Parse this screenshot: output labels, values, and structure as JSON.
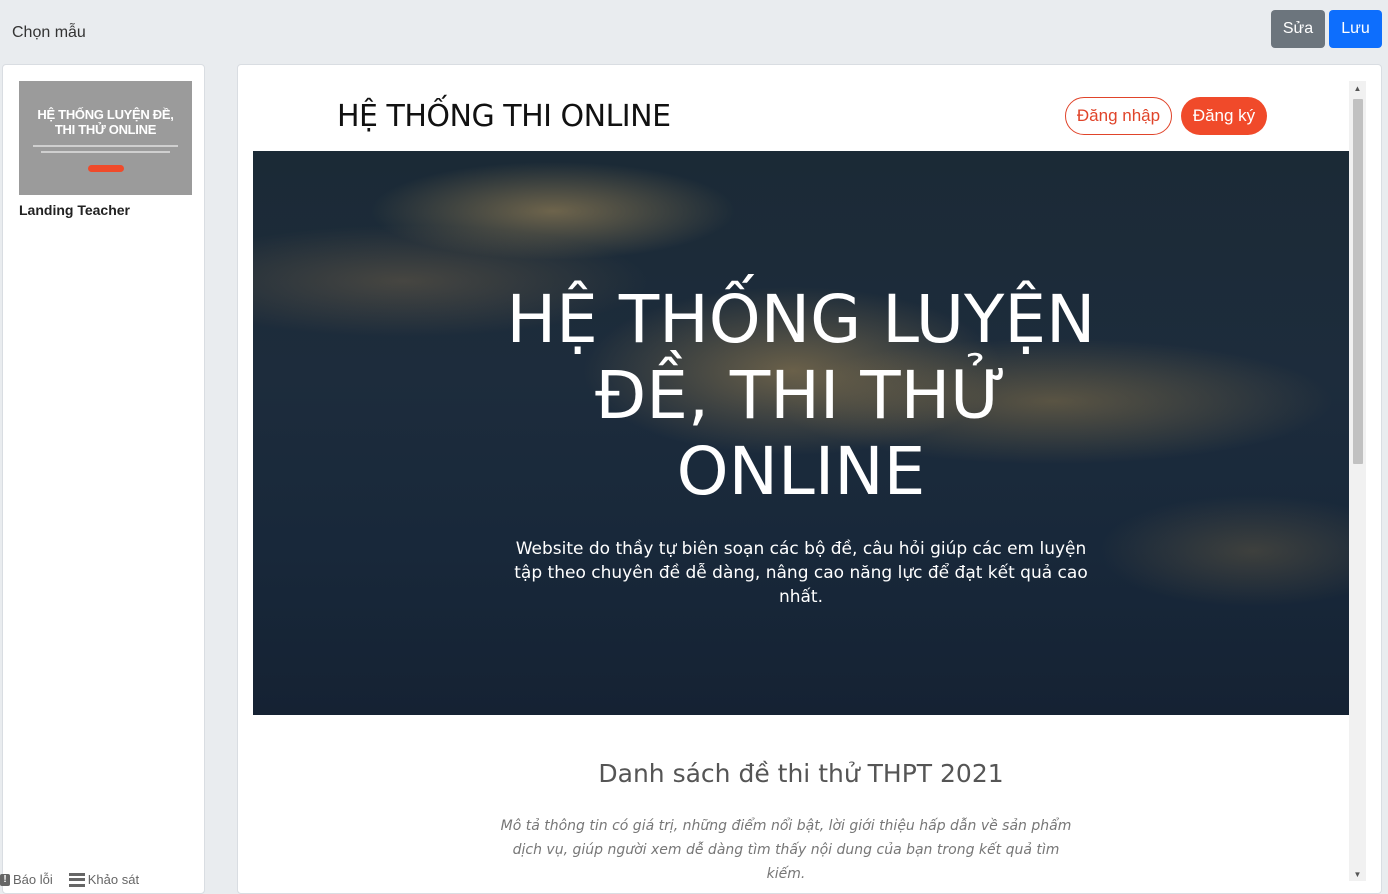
{
  "topbar": {
    "title": "Chọn mẫu",
    "edit_label": "Sửa",
    "save_label": "Lưu"
  },
  "sidebar": {
    "templates": [
      {
        "thumbnail_title_line1": "HỆ THỐNG LUYỆN ĐỀ,",
        "thumbnail_title_line2": "THI THỬ ONLINE",
        "name": "Landing Teacher"
      }
    ]
  },
  "footer": {
    "report_label": "Báo lỗi",
    "survey_label": "Khảo sát"
  },
  "preview": {
    "site_title": "HỆ THỐNG THI ONLINE",
    "login_label": "Đăng nhập",
    "register_label": "Đăng ký",
    "hero": {
      "title_line1": "HỆ THỐNG LUYỆN",
      "title_line2": "ĐỀ, THI THỬ",
      "title_line3": "ONLINE",
      "subtitle": "Website do thầy tự biên soạn các bộ đề, câu hỏi giúp các em luyện tập theo chuyên đề dễ dàng, nâng cao năng lực để đạt kết quả cao nhất."
    },
    "section": {
      "title": "Danh sách đề thi thử THPT 2021",
      "description": "Mô tả thông tin có giá trị, những điểm nổi bật, lời giới thiệu hấp dẫn về sản phẩm dịch vụ, giúp người xem dễ dàng tìm thấy nội dung của bạn trong kết quả tìm kiếm."
    }
  },
  "colors": {
    "primary": "#0d6efd",
    "secondary": "#6c757d",
    "accent": "#f04a2a"
  },
  "icons": {
    "report": "exclamation-icon",
    "survey": "list-icon"
  }
}
